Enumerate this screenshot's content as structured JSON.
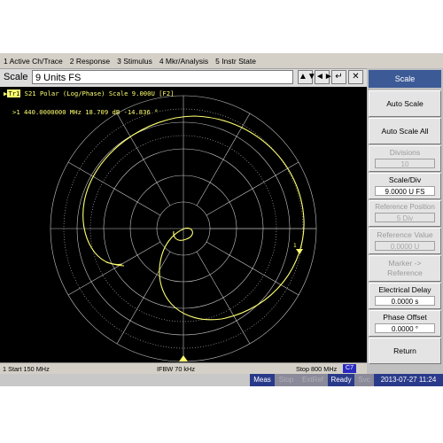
{
  "menu": {
    "items": [
      "1 Active Ch/Trace",
      "2 Response",
      "3 Stimulus",
      "4 Mkr/Analysis",
      "5 Instr State"
    ]
  },
  "entry_bar": {
    "label": "Scale",
    "value": "9 Units FS",
    "buttons": [
      "▲▼",
      "◄►",
      "↵",
      "✕"
    ]
  },
  "trace": {
    "badge": "Tr1",
    "header": "S21 Polar (Log/Phase) Scale 9.000U [F2]",
    "marker": ">1  440.0000000 MHz  18.709 dB -14.836 °"
  },
  "status": {
    "start": "1  Start 150 MHz",
    "ifbw": "IFBW 70 kHz",
    "stop": "Stop 800 MHz",
    "channel": "C7"
  },
  "system_bar": {
    "meas": "Meas",
    "stop": "Stop",
    "extref": "ExtRef",
    "ready": "Ready",
    "svc": "Svc",
    "datetime": "2013-07-27 11:24"
  },
  "softkeys": {
    "title": "Scale",
    "auto_scale": "Auto Scale",
    "auto_scale_all": "Auto Scale All",
    "divisions_label": "Divisions",
    "divisions_value": "10",
    "scale_div_label": "Scale/Div",
    "scale_div_value": "9.0000 U FS",
    "ref_pos_label": "Reference Position",
    "ref_pos_value": "5 Div",
    "ref_value_label": "Reference Value",
    "ref_value_value": "0.0000 U",
    "marker_ref_label": "Marker -> Reference",
    "elec_delay_label": "Electrical Delay",
    "elec_delay_value": "0.0000 s",
    "phase_offset_label": "Phase Offset",
    "phase_offset_value": "0.0000 °",
    "return": "Return"
  },
  "colors": {
    "trace": "#ffff70",
    "grid": "#c8c8c8",
    "softkey_title": "#3c5a96",
    "sysbar_active": "#2a3a8a"
  }
}
